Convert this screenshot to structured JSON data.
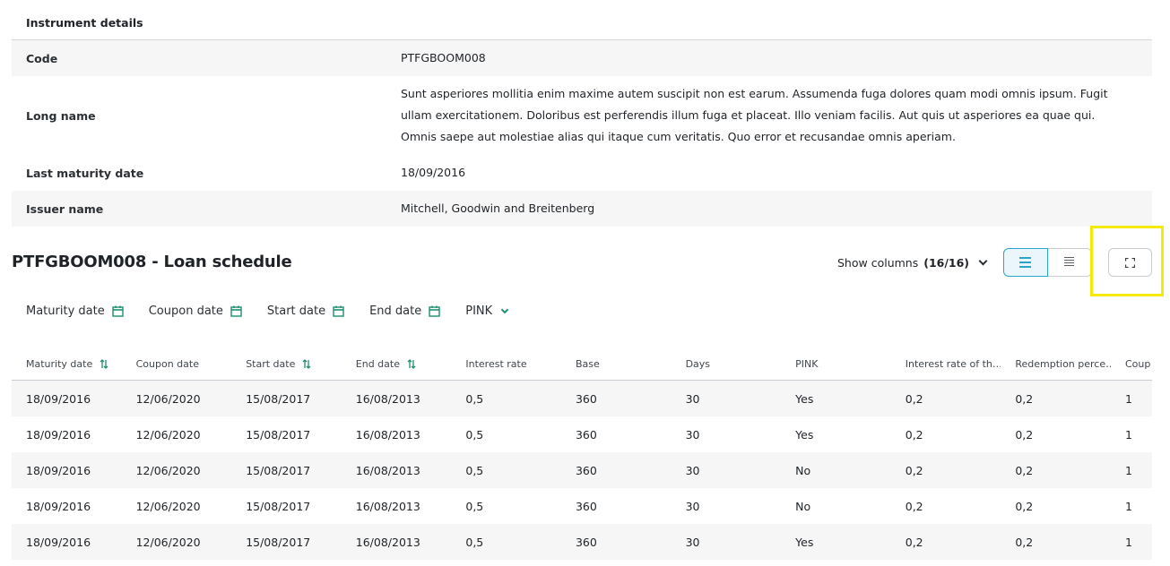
{
  "details": {
    "title": "Instrument details",
    "rows": [
      {
        "key": "Code",
        "value": "PTFGBOOM008"
      },
      {
        "key": "Long name",
        "value": "Sunt asperiores mollitia enim maxime autem suscipit non est earum. Assumenda fuga dolores quam modi omnis ipsum. Fugit ullam exercitationem. Doloribus est perferendis illum fuga et placeat. Illo veniam facilis. Aut quis ut asperiores ea quae qui. Omnis saepe aut molestiae alias qui itaque cum veritatis. Quo error et recusandae omnis aperiam."
      },
      {
        "key": "Last maturity date",
        "value": "18/09/2016"
      },
      {
        "key": "Issuer name",
        "value": "Mitchell, Goodwin and Breitenberg"
      }
    ]
  },
  "schedule": {
    "title": "PTFGBOOM008 - Loan schedule",
    "show_columns_label": "Show columns",
    "show_columns_count": "(16/16)"
  },
  "filters": [
    "Maturity date",
    "Coupon date",
    "Start date",
    "End date",
    "PINK"
  ],
  "table": {
    "columns": [
      "Maturity date",
      "Coupon date",
      "Start date",
      "End date",
      "Interest rate",
      "Base",
      "Days",
      "PINK",
      "Interest rate of th…",
      "Redemption perce…",
      "Coupo"
    ],
    "rows": [
      [
        "18/09/2016",
        "12/06/2020",
        "15/08/2017",
        "16/08/2013",
        "0,5",
        "360",
        "30",
        "Yes",
        "0,2",
        "0,2",
        "1"
      ],
      [
        "18/09/2016",
        "12/06/2020",
        "15/08/2017",
        "16/08/2013",
        "0,5",
        "360",
        "30",
        "Yes",
        "0,2",
        "0,2",
        "1"
      ],
      [
        "18/09/2016",
        "12/06/2020",
        "15/08/2017",
        "16/08/2013",
        "0,5",
        "360",
        "30",
        "No",
        "0,2",
        "0,2",
        "1"
      ],
      [
        "18/09/2016",
        "12/06/2020",
        "15/08/2017",
        "16/08/2013",
        "0,5",
        "360",
        "30",
        "No",
        "0,2",
        "0,2",
        "1"
      ],
      [
        "18/09/2016",
        "12/06/2020",
        "15/08/2017",
        "16/08/2013",
        "0,5",
        "360",
        "30",
        "Yes",
        "0,2",
        "0,2",
        "1"
      ]
    ]
  },
  "colors": {
    "accent": "#2aa4c8",
    "green_icon": "#1d8f6e",
    "highlight": "#f5ea05"
  },
  "icons": {
    "list_view": "list-icon",
    "compact_view": "compact-list-icon",
    "expand": "fullscreen-icon",
    "calendar": "calendar-icon",
    "sort": "sort-icon"
  }
}
